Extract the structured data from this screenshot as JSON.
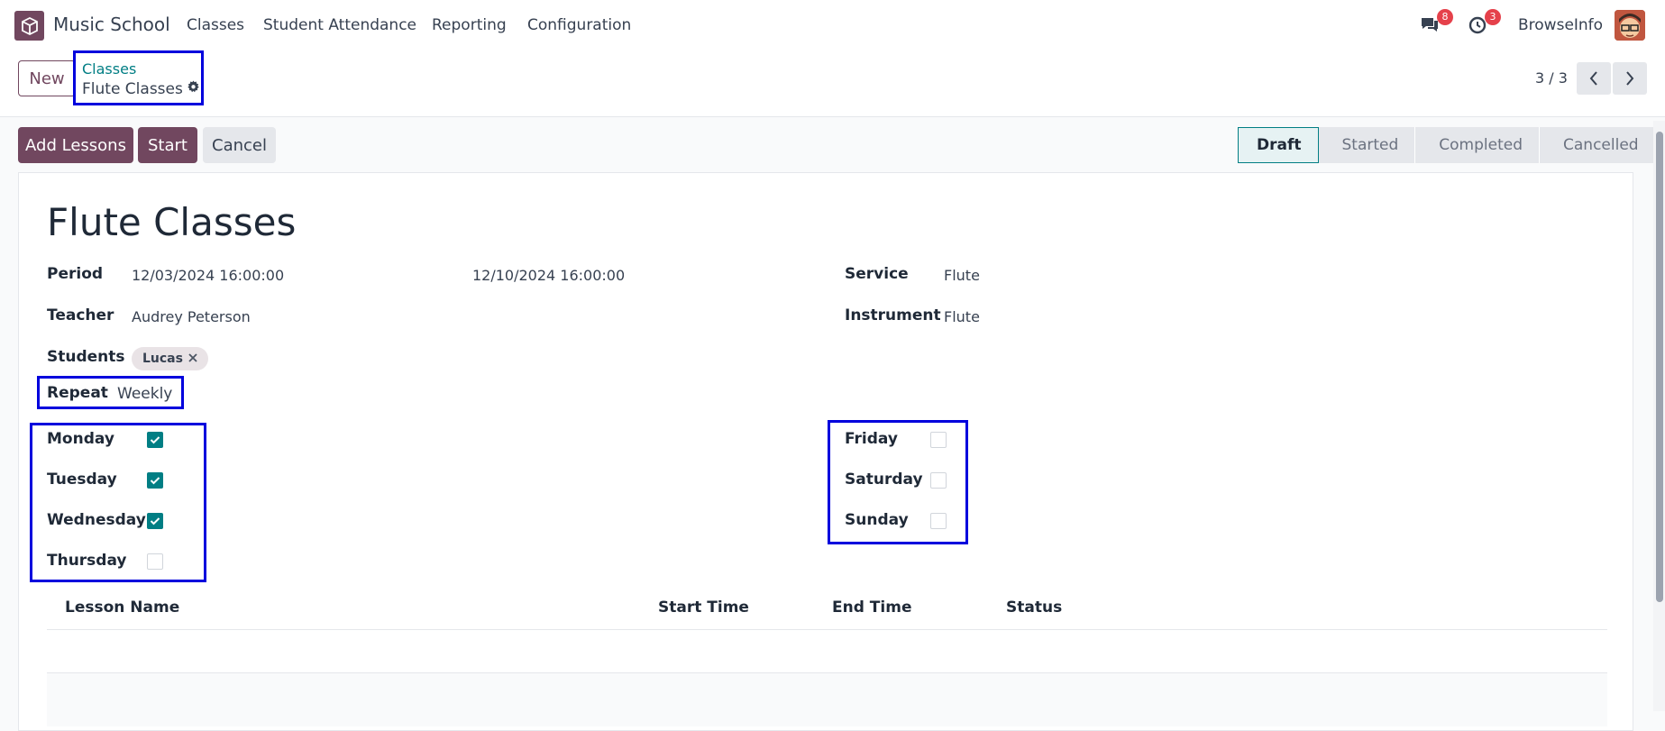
{
  "topbar": {
    "app_name": "Music School",
    "menu": [
      "Classes",
      "Student Attendance",
      "Reporting",
      "Configuration"
    ],
    "messages_count": "8",
    "activities_count": "3",
    "username": "BrowseInfo"
  },
  "control": {
    "new_label": "New",
    "breadcrumb_parent": "Classes",
    "breadcrumb_current": "Flute Classes",
    "pager": "3 / 3"
  },
  "actions": {
    "add_lessons": "Add Lessons",
    "start": "Start",
    "cancel": "Cancel"
  },
  "stages": [
    "Draft",
    "Started",
    "Completed",
    "Cancelled"
  ],
  "active_stage": "Draft",
  "record": {
    "title": "Flute Classes",
    "period_label": "Period",
    "period_start": "12/03/2024 16:00:00",
    "period_end": "12/10/2024 16:00:00",
    "service_label": "Service",
    "service": "Flute",
    "teacher_label": "Teacher",
    "teacher": "Audrey Peterson",
    "instrument_label": "Instrument",
    "instrument": "Flute",
    "students_label": "Students",
    "students": [
      "Lucas"
    ],
    "repeat_label": "Repeat",
    "repeat": "Weekly",
    "days": {
      "monday": {
        "label": "Monday",
        "checked": true
      },
      "tuesday": {
        "label": "Tuesday",
        "checked": true
      },
      "wednesday": {
        "label": "Wednesday",
        "checked": true
      },
      "thursday": {
        "label": "Thursday",
        "checked": false
      },
      "friday": {
        "label": "Friday",
        "checked": false
      },
      "saturday": {
        "label": "Saturday",
        "checked": false
      },
      "sunday": {
        "label": "Sunday",
        "checked": false
      }
    }
  },
  "lessons_table": {
    "columns": [
      "Lesson Name",
      "Start Time",
      "End Time",
      "Status"
    ]
  },
  "colors": {
    "brand": "#71475f",
    "accent": "#017e84",
    "highlight": "#0000dd"
  }
}
